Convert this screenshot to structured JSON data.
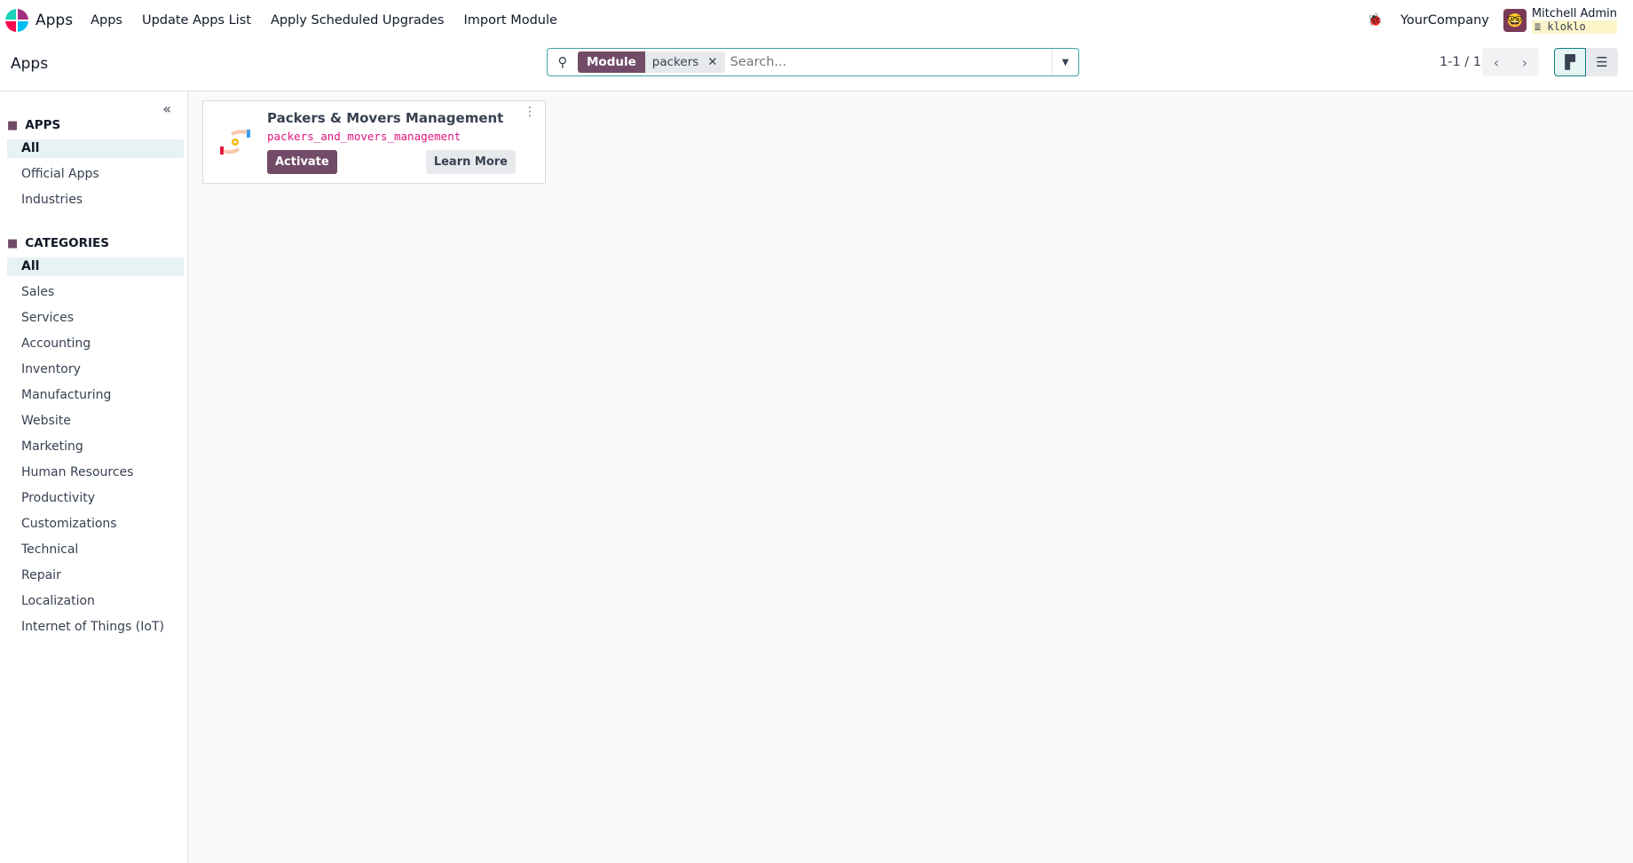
{
  "navbar": {
    "brand": "Apps",
    "menu": [
      "Apps",
      "Update Apps List",
      "Apply Scheduled Upgrades",
      "Import Module"
    ],
    "company": "YourCompany",
    "user_name": "Mitchell Admin",
    "database": "kloklo"
  },
  "control_panel": {
    "title": "Apps",
    "facet_key": "Module",
    "facet_value": "packers",
    "search_placeholder": "Search...",
    "pager": "1-1 / 1"
  },
  "sidebar": {
    "apps_header": "APPS",
    "apps": [
      "All",
      "Official Apps",
      "Industries"
    ],
    "categories_header": "CATEGORIES",
    "categories": [
      "All",
      "Sales",
      "Services",
      "Accounting",
      "Inventory",
      "Manufacturing",
      "Website",
      "Marketing",
      "Human Resources",
      "Productivity",
      "Customizations",
      "Technical",
      "Repair",
      "Localization",
      "Internet of Things (IoT)"
    ]
  },
  "card": {
    "name": "Packers & Movers Management",
    "technical_name": "packers_and_movers_management",
    "activate": "Activate",
    "learn_more": "Learn More"
  },
  "colors": {
    "primary": "#714B67",
    "accent": "#0f8184",
    "tech": "#e0147d"
  }
}
